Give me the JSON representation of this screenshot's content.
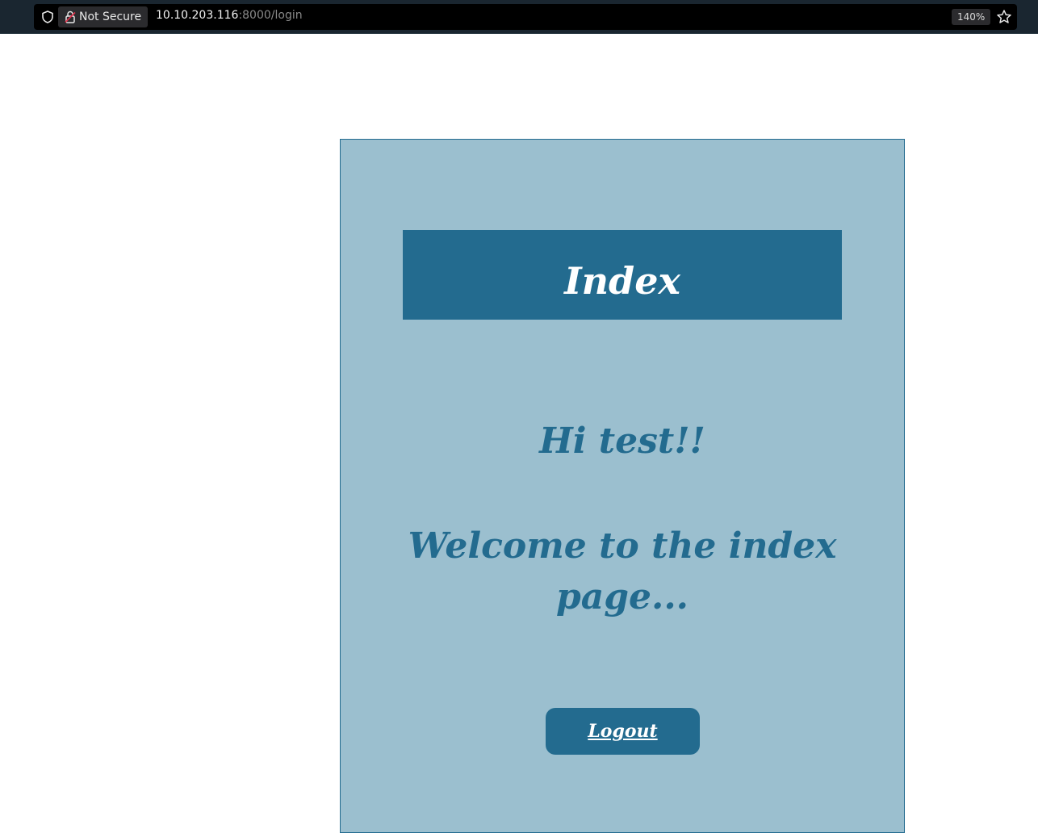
{
  "browser": {
    "security_label": "Not Secure",
    "url_host": "10.10.203.116",
    "url_rest": ":8000/login",
    "zoom": "140%",
    "icons": {
      "shield": "shield-icon",
      "lock": "lock-broken-icon",
      "bookmark": "star-icon"
    }
  },
  "page": {
    "header_title": "Index",
    "greeting": "Hi test!!",
    "welcome_message": "Welcome to the index page...",
    "logout_label": "Logout"
  },
  "colors": {
    "primary": "#236b8f",
    "card_background": "#9bbfcf",
    "page_background": "#ffffff",
    "browser_bar": "#1a2630"
  }
}
